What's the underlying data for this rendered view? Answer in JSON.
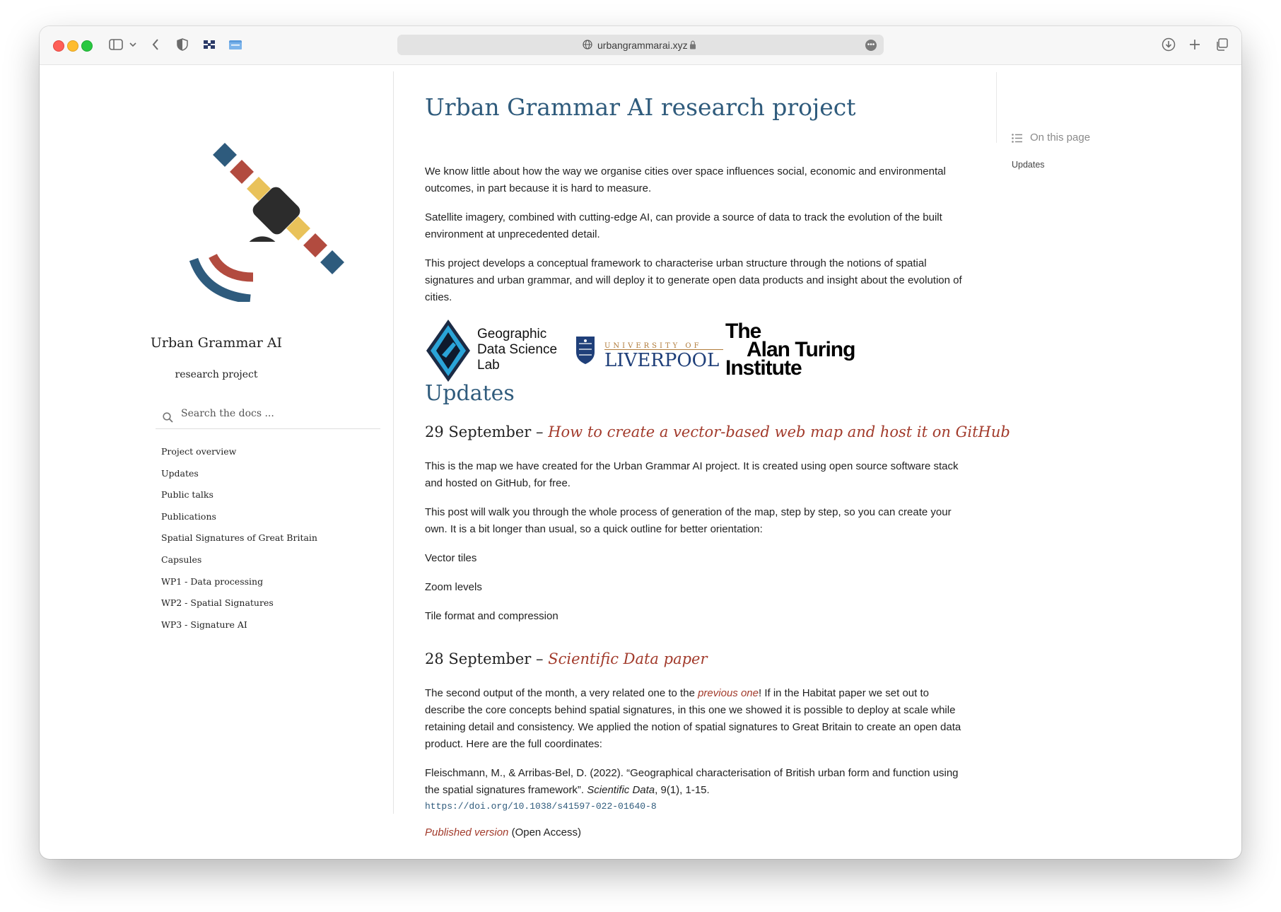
{
  "browser": {
    "url": "urbangrammarai.xyz"
  },
  "sidebar": {
    "title": "Urban Grammar AI",
    "subtitle": "research project",
    "search_placeholder": "Search the docs ...",
    "nav": [
      "Project overview",
      "Updates",
      "Public talks",
      "Publications",
      "Spatial Signatures of Great Britain",
      "Capsules",
      "WP1 - Data processing",
      "WP2 - Spatial Signatures",
      "WP3 - Signature AI"
    ],
    "logo_colors": [
      "#2e5b7d",
      "#b24b3f",
      "#e9c25a",
      "#2c2c2c"
    ]
  },
  "main": {
    "title": "Urban Grammar AI research project",
    "intro": [
      "We know little about how the way we organise cities over space influences social, economic and environmental outcomes, in part because it is hard to measure.",
      "Satellite imagery, combined with cutting-edge AI, can provide a source of data to track the evolution of the built environment at unprecedented detail.",
      "This project develops a conceptual framework to characterise urban structure through the notions of spatial signatures and urban grammar, and will deploy it to generate open data products and insight about the evolution of cities."
    ],
    "logos": {
      "gdsl": [
        "Geographic",
        "Data Science",
        "Lab"
      ],
      "liverpool_top": "UNIVERSITY OF",
      "liverpool_name": "LIVERPOOL",
      "turing": [
        "The",
        "Alan Turing",
        "Institute"
      ]
    },
    "updates_heading": "Updates",
    "post1": {
      "date": "29 September –",
      "link": "How to create a vector-based web map and host it on GitHub",
      "p1": "This is the map we have created for the Urban Grammar AI project. It is created using open source software stack and hosted on GitHub, for free.",
      "p2": "This post will walk you through the whole process of generation of the map, step by step, so you can create your own. It is a bit longer than usual, so a quick outline for better orientation:",
      "outline": [
        "Vector tiles",
        "Zoom levels",
        "Tile format and compression"
      ]
    },
    "post2": {
      "date": "28 September –",
      "link": "Scientific Data paper",
      "p1_a": "The second output of the month, a very related one to the ",
      "p1_link": "previous one",
      "p1_b": "! If in the Habitat paper we set out to describe the core concepts behind spatial signatures, in this one we showed it is possible to deploy at scale while retaining detail and consistency. We applied the notion of spatial signatures to Great Britain to create an open data product. Here are the full coordinates:",
      "cite_a": "Fleischmann, M., & Arribas-Bel, D. (2022). “Geographical characterisation of British urban form and function using the spatial signatures framework”. ",
      "cite_journal": "Scientific Data",
      "cite_b": ", 9(1), 1-15.",
      "doi": "https://doi.org/10.1038/s41597-022-01640-8",
      "published_link": "Published version",
      "published_note": " (Open Access)"
    }
  },
  "toc": {
    "heading": "On this page",
    "items": [
      "Updates"
    ]
  }
}
